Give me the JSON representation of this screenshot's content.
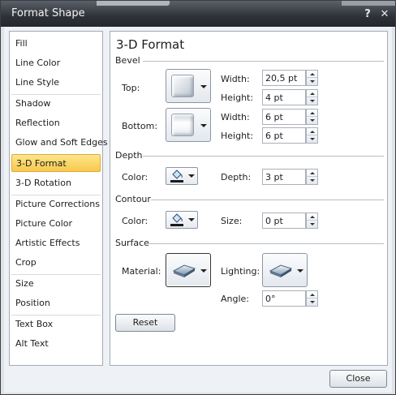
{
  "window": {
    "title": "Format Shape"
  },
  "titlebar": {
    "help_label": "?",
    "close_label": "✕"
  },
  "nav": {
    "items": [
      "Fill",
      "Line Color",
      "Line Style",
      "Shadow",
      "Reflection",
      "Glow and Soft Edges",
      "3-D Format",
      "3-D Rotation",
      "Picture Corrections",
      "Picture Color",
      "Artistic Effects",
      "Crop",
      "Size",
      "Position",
      "Text Box",
      "Alt Text"
    ],
    "selected": "3-D Format"
  },
  "panel": {
    "title": "3-D Format",
    "bevel": {
      "section": "Bevel",
      "top_label": "Top:",
      "bottom_label": "Bottom:",
      "top_width_label": "Width:",
      "top_width": "20,5 pt",
      "top_height_label": "Height:",
      "top_height": "4 pt",
      "bottom_width_label": "Width:",
      "bottom_width": "6 pt",
      "bottom_height_label": "Height:",
      "bottom_height": "6 pt"
    },
    "depth": {
      "section": "Depth",
      "color_label": "Color:",
      "depth_label": "Depth:",
      "depth_value": "3 pt"
    },
    "contour": {
      "section": "Contour",
      "color_label": "Color:",
      "size_label": "Size:",
      "size_value": "0 pt"
    },
    "surface": {
      "section": "Surface",
      "material_label": "Material:",
      "lighting_label": "Lighting:",
      "angle_label": "Angle:",
      "angle_value": "0°"
    },
    "reset_label": "Reset"
  },
  "footer": {
    "close_label": "Close"
  },
  "colors": {
    "selected_bg": "#f8c94d",
    "titlebar": "#2e3238",
    "panel_border": "#a4abb5"
  },
  "icons": [
    "help-icon",
    "close-icon",
    "bevel-top-icon",
    "bevel-bottom-icon",
    "paint-bucket-icon",
    "material-icon",
    "lighting-icon",
    "spin-up-icon",
    "spin-down-icon",
    "dropdown-arrow-icon"
  ]
}
